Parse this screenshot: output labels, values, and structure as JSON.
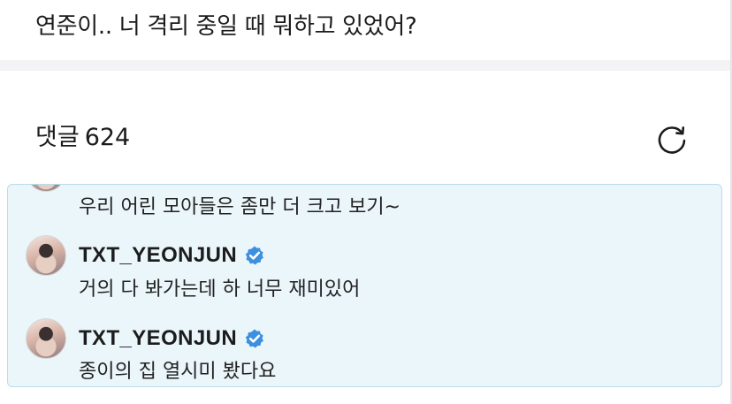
{
  "post": {
    "title": "연준이.. 너 격리 중일 때 뭐하고 있었어?"
  },
  "comments": {
    "label": "댓글",
    "count": "624",
    "refresh_icon": "refresh-icon"
  },
  "thread": {
    "accent_bg": "#ebf6fb",
    "accent_border": "#b9dceb",
    "verified_color": "#3d8fe0",
    "first_reply_text": "우리 어린 모아들은 좀만 더 크고 보기~",
    "replies": [
      {
        "author": "TXT_YEONJUN",
        "verified": true,
        "text": "거의 다 봐가는데 하 너무 재미있어"
      },
      {
        "author": "TXT_YEONJUN",
        "verified": true,
        "text": "종이의 집 열시미 봤다요"
      }
    ]
  }
}
